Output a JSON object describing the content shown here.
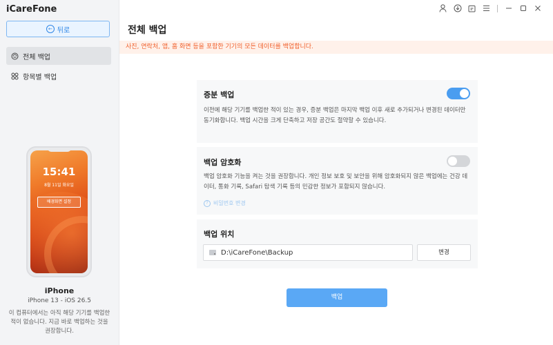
{
  "app": {
    "title": "iCareFone"
  },
  "sidebar": {
    "back_label": "뒤로",
    "items": [
      {
        "label": "전체 백업",
        "icon": "full-backup-icon",
        "active": true
      },
      {
        "label": "항목별 백업",
        "icon": "selective-backup-icon",
        "active": false
      }
    ]
  },
  "device": {
    "lock_time": "15:41",
    "lock_date": "8월 11일 화요일",
    "lock_button": "배경화면 설정",
    "name": "iPhone",
    "model": "iPhone 13 - iOS 26.5",
    "note": "이 컴퓨터에서는 아직 해당 기기를 백업한 적이 없습니다. 지금 바로 백업하는 것을 권장합니다."
  },
  "topbar": {
    "icons": [
      "user-icon",
      "download-icon",
      "feedback-icon",
      "menu-icon",
      "minimize-icon",
      "maximize-icon",
      "close-icon"
    ]
  },
  "main": {
    "title": "전체 백업",
    "notice": "사진, 연락처, 앱, 홈 화면 등을 포함한 기기의 모든 데이터를 백업합니다.",
    "incremental": {
      "title": "증분 백업",
      "description": "이전에 해당 기기를 백업한 적이 있는 경우, 증분 백업은 마지막 백업 이후 새로 추가되거나 변경된 데이터만 동기화합니다. 백업 시간을 크게 단축하고 저장 공간도 절약할 수 있습니다.",
      "enabled": true
    },
    "encryption": {
      "title": "백업 암호화",
      "description": "백업 암호화 기능을 켜는 것을 권장합니다. 개인 정보 보호 및 보안을 위해 암호화되지 않은 백업에는 건강 데이터, 통화 기록, Safari 탐색 기록 등의 민감한 정보가 포함되지 않습니다.",
      "enabled": false,
      "password_link": "비밀번호 변경"
    },
    "location": {
      "title": "백업 위치",
      "path": "D:\\iCareFone\\Backup",
      "change_label": "변경"
    },
    "backup_button": "백업"
  },
  "colors": {
    "accent": "#4a9df0",
    "notice_text": "#f05f2a",
    "notice_bg": "#fff1ea",
    "button": "#5aa8f5"
  }
}
